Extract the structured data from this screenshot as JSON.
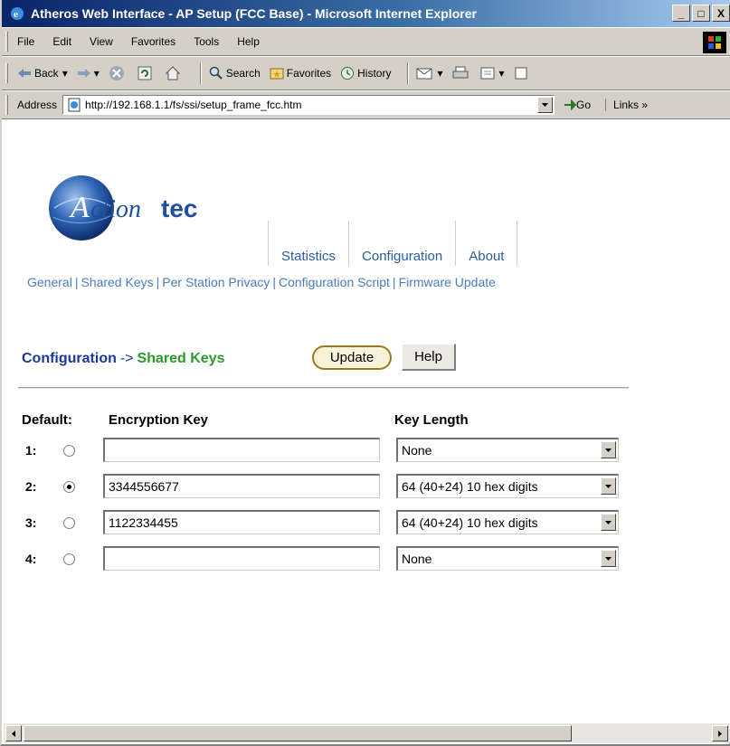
{
  "window": {
    "title": "Atheros Web Interface - AP Setup (FCC Base) - Microsoft Internet Explorer",
    "buttons": [
      "_",
      "□",
      "X"
    ]
  },
  "menu": [
    "File",
    "Edit",
    "View",
    "Favorites",
    "Tools",
    "Help"
  ],
  "toolbar": {
    "back": "Back",
    "search": "Search",
    "favorites": "Favorites",
    "history": "History"
  },
  "address": {
    "label": "Address",
    "url": "http://192.168.1.1/fs/ssi/setup_frame_fcc.htm",
    "go": "Go",
    "links": "Links"
  },
  "logo": {
    "text": "Actiontec",
    "accent": "#1f4fa0"
  },
  "nav": [
    "Statistics",
    "Configuration",
    "About"
  ],
  "sublinks": [
    "General",
    "Shared Keys",
    "Per Station Privacy",
    "Configuration Script",
    "Firmware Update"
  ],
  "breadcrumb": {
    "root": "Configuration",
    "arrow": "->",
    "current": "Shared Keys"
  },
  "buttons": {
    "update": "Update",
    "help": "Help"
  },
  "table": {
    "headers": {
      "default": "Default:",
      "key": "Encryption Key",
      "length": "Key Length"
    },
    "rows": [
      {
        "num": "1:",
        "checked": false,
        "key": "",
        "length": "None"
      },
      {
        "num": "2:",
        "checked": true,
        "key": "3344556677",
        "length": "64 (40+24) 10 hex digits"
      },
      {
        "num": "3:",
        "checked": false,
        "key": "1122334455",
        "length": "64 (40+24) 10 hex digits"
      },
      {
        "num": "4:",
        "checked": false,
        "key": "",
        "length": "None"
      }
    ]
  }
}
